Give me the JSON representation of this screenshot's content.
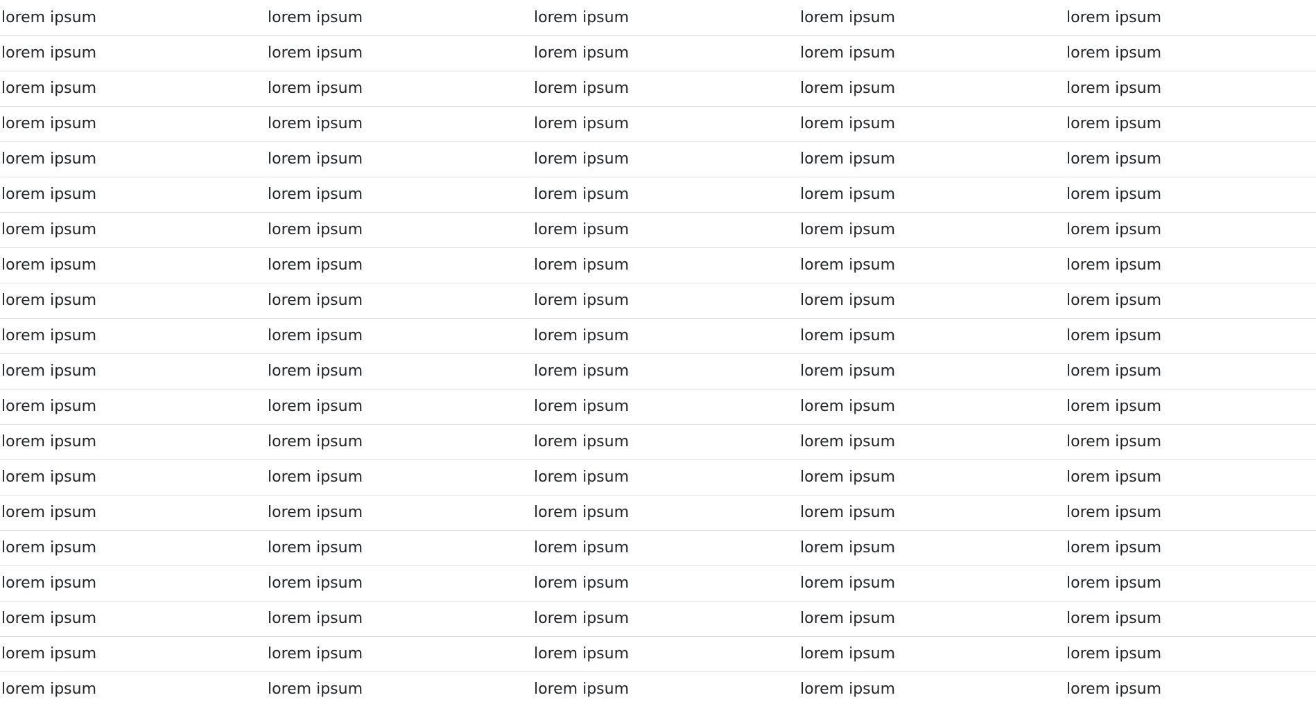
{
  "table": {
    "rows": [
      [
        "lorem ipsum",
        "lorem ipsum",
        "lorem ipsum",
        "lorem ipsum",
        "lorem ipsum"
      ],
      [
        "lorem ipsum",
        "lorem ipsum",
        "lorem ipsum",
        "lorem ipsum",
        "lorem ipsum"
      ],
      [
        "lorem ipsum",
        "lorem ipsum",
        "lorem ipsum",
        "lorem ipsum",
        "lorem ipsum"
      ],
      [
        "lorem ipsum",
        "lorem ipsum",
        "lorem ipsum",
        "lorem ipsum",
        "lorem ipsum"
      ],
      [
        "lorem ipsum",
        "lorem ipsum",
        "lorem ipsum",
        "lorem ipsum",
        "lorem ipsum"
      ],
      [
        "lorem ipsum",
        "lorem ipsum",
        "lorem ipsum",
        "lorem ipsum",
        "lorem ipsum"
      ],
      [
        "lorem ipsum",
        "lorem ipsum",
        "lorem ipsum",
        "lorem ipsum",
        "lorem ipsum"
      ],
      [
        "lorem ipsum",
        "lorem ipsum",
        "lorem ipsum",
        "lorem ipsum",
        "lorem ipsum"
      ],
      [
        "lorem ipsum",
        "lorem ipsum",
        "lorem ipsum",
        "lorem ipsum",
        "lorem ipsum"
      ],
      [
        "lorem ipsum",
        "lorem ipsum",
        "lorem ipsum",
        "lorem ipsum",
        "lorem ipsum"
      ],
      [
        "lorem ipsum",
        "lorem ipsum",
        "lorem ipsum",
        "lorem ipsum",
        "lorem ipsum"
      ],
      [
        "lorem ipsum",
        "lorem ipsum",
        "lorem ipsum",
        "lorem ipsum",
        "lorem ipsum"
      ],
      [
        "lorem ipsum",
        "lorem ipsum",
        "lorem ipsum",
        "lorem ipsum",
        "lorem ipsum"
      ],
      [
        "lorem ipsum",
        "lorem ipsum",
        "lorem ipsum",
        "lorem ipsum",
        "lorem ipsum"
      ],
      [
        "lorem ipsum",
        "lorem ipsum",
        "lorem ipsum",
        "lorem ipsum",
        "lorem ipsum"
      ],
      [
        "lorem ipsum",
        "lorem ipsum",
        "lorem ipsum",
        "lorem ipsum",
        "lorem ipsum"
      ],
      [
        "lorem ipsum",
        "lorem ipsum",
        "lorem ipsum",
        "lorem ipsum",
        "lorem ipsum"
      ],
      [
        "lorem ipsum",
        "lorem ipsum",
        "lorem ipsum",
        "lorem ipsum",
        "lorem ipsum"
      ],
      [
        "lorem ipsum",
        "lorem ipsum",
        "lorem ipsum",
        "lorem ipsum",
        "lorem ipsum"
      ],
      [
        "lorem ipsum",
        "lorem ipsum",
        "lorem ipsum",
        "lorem ipsum",
        "lorem ipsum"
      ]
    ]
  }
}
